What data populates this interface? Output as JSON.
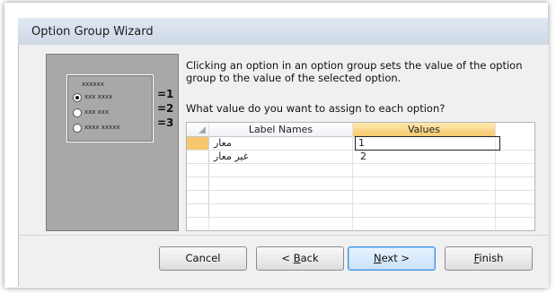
{
  "window": {
    "title": "Option Group Wizard"
  },
  "preview": {
    "group_caption": "xxxxxx",
    "options": [
      {
        "text": "xxx xxxx",
        "selected": true,
        "value_label": "=1"
      },
      {
        "text": "xxx xxx",
        "selected": false,
        "value_label": "=2"
      },
      {
        "text": "xxxx xxxxx",
        "selected": false,
        "value_label": "=3"
      }
    ]
  },
  "instructions": "Clicking an option in an option group sets the value of the option group to the value of the selected option.",
  "question": "What value do you want to assign to each option?",
  "grid": {
    "columns": [
      "Label Names",
      "Values"
    ],
    "rows": [
      {
        "label": "معار",
        "value": "1"
      },
      {
        "label": "غير معار",
        "value": "2"
      }
    ]
  },
  "buttons": {
    "cancel": "Cancel",
    "back_prefix": "< ",
    "back_hot": "B",
    "back_rest": "ack",
    "next_hot": "N",
    "next_rest": "ext >",
    "finish_hot": "F",
    "finish_rest": "inish"
  },
  "colors": {
    "accent": "#f6c86e",
    "default_button": "#3a8ee6"
  }
}
